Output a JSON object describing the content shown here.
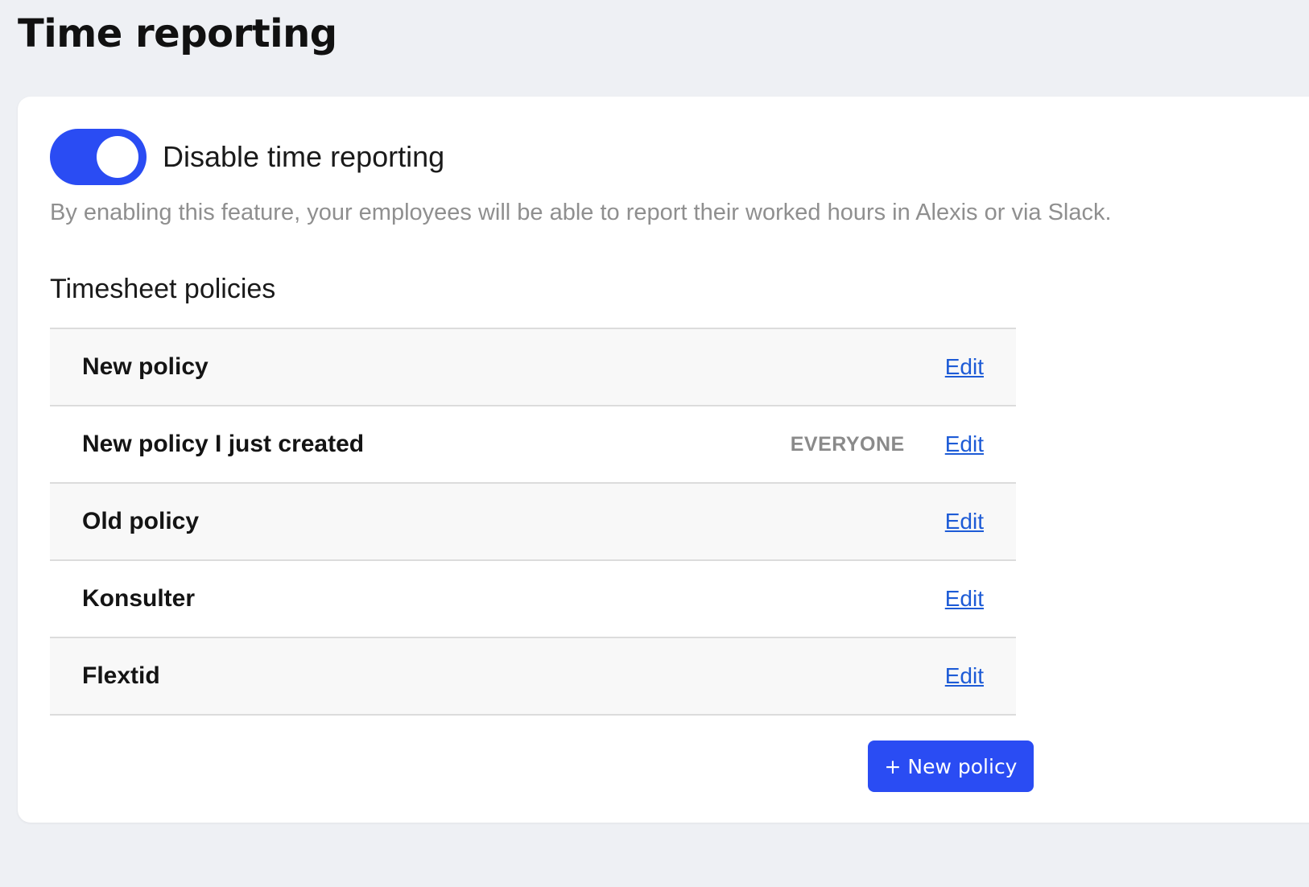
{
  "page": {
    "title": "Time reporting"
  },
  "settings": {
    "toggle_label": "Disable time reporting",
    "toggle_on": true,
    "description": "By enabling this feature, your employees will be able to report their worked hours in Alexis or via Slack."
  },
  "policies": {
    "section_title": "Timesheet policies",
    "items": [
      {
        "name": "New policy",
        "badge": "",
        "edit_label": "Edit"
      },
      {
        "name": "New policy I just created",
        "badge": "EVERYONE",
        "edit_label": "Edit"
      },
      {
        "name": "Old policy",
        "badge": "",
        "edit_label": "Edit"
      },
      {
        "name": "Konsulter",
        "badge": "",
        "edit_label": "Edit"
      },
      {
        "name": "Flextid",
        "badge": "",
        "edit_label": "Edit"
      }
    ],
    "new_button_label": "+ New policy"
  },
  "colors": {
    "accent": "#2a4cf3",
    "link": "#1d5bd6",
    "background": "#eef0f4"
  }
}
